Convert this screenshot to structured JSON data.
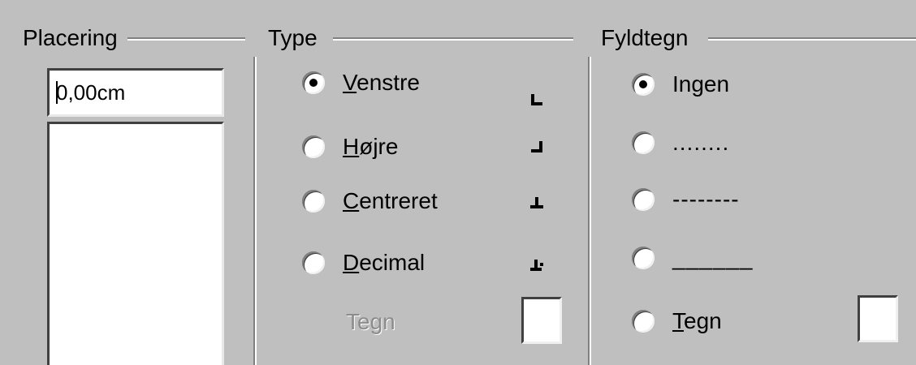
{
  "placering": {
    "title": "Placering",
    "value": "0,00cm"
  },
  "type": {
    "title": "Type",
    "options": [
      {
        "label_accel": "V",
        "label_rest": "enstre",
        "checked": true,
        "glyph": "┗"
      },
      {
        "label_accel": "H",
        "label_rest": "øjre",
        "checked": false,
        "glyph": "┛"
      },
      {
        "label_accel": "C",
        "label_rest": "entreret",
        "checked": false,
        "glyph": "┻"
      },
      {
        "label_accel": "D",
        "label_rest": "ecimal",
        "checked": false,
        "glyph": "┻"
      }
    ],
    "char_label": "Tegn",
    "char_value": ""
  },
  "fyldtegn": {
    "title": "Fyldtegn",
    "options": [
      {
        "label": "Ingen",
        "checked": true
      },
      {
        "label": "........",
        "checked": false
      },
      {
        "label": "--------",
        "checked": false
      },
      {
        "label": "______",
        "checked": false
      },
      {
        "label_accel": "T",
        "label_rest": "egn",
        "checked": false
      }
    ],
    "char_value": ""
  }
}
